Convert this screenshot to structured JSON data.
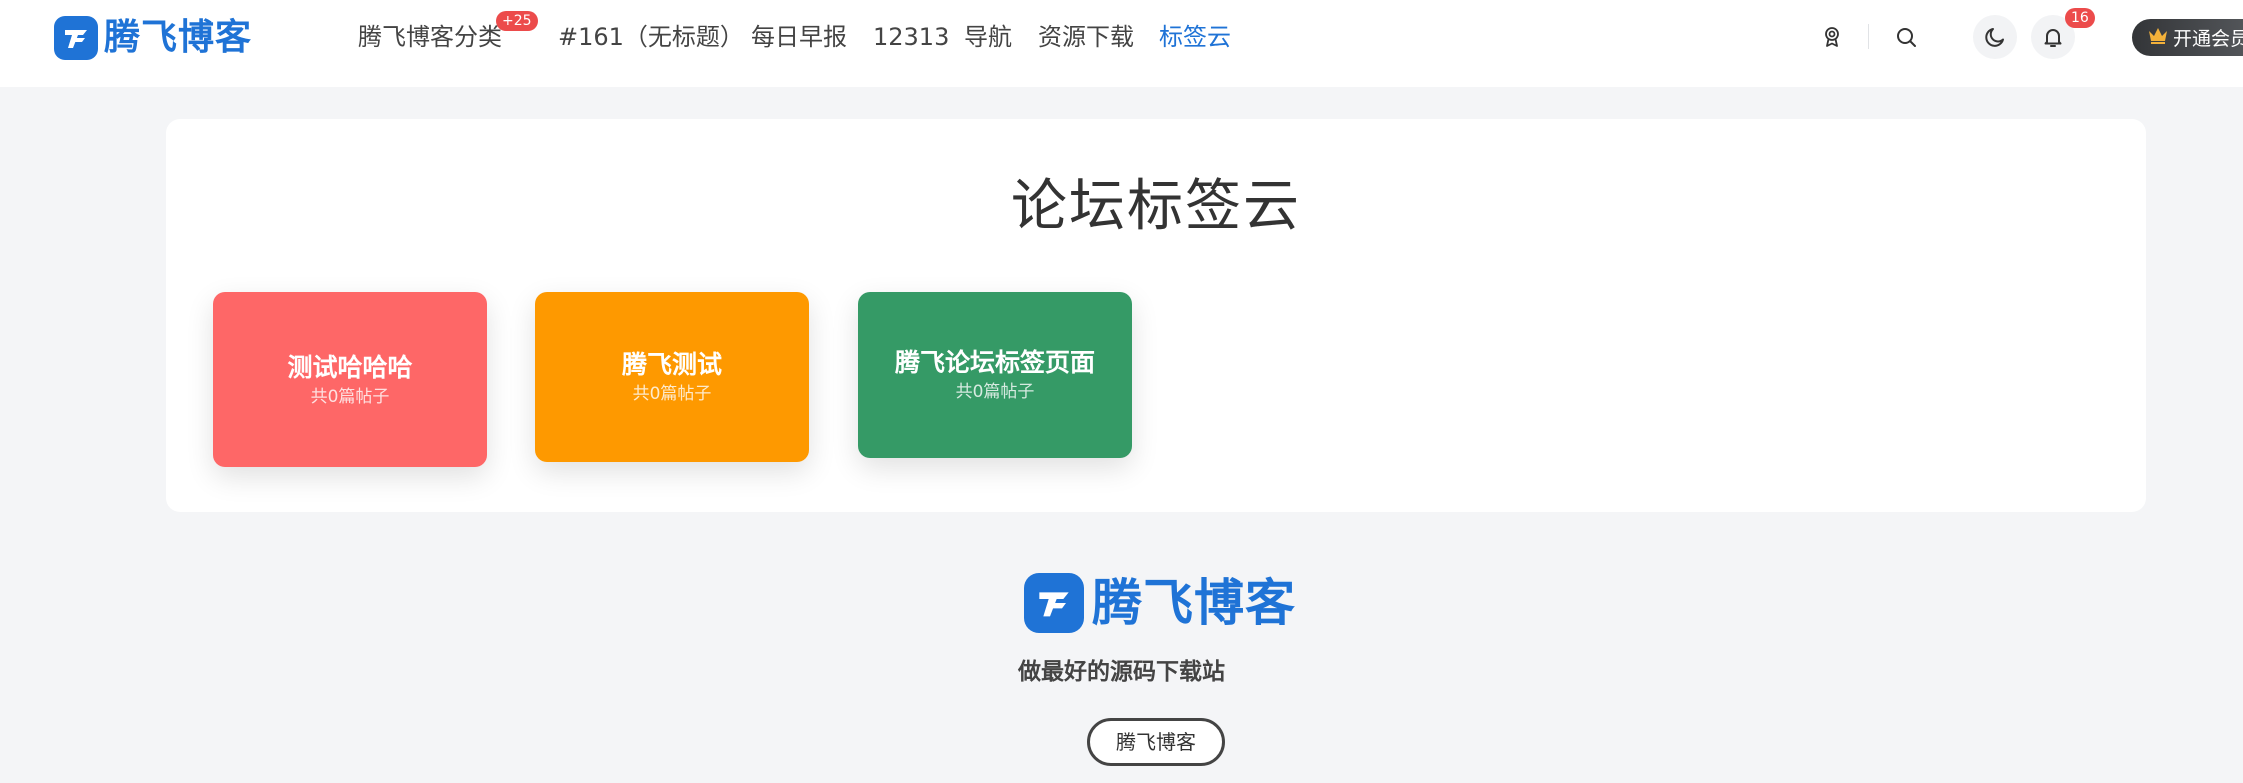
{
  "header": {
    "logo_text": "腾飞博客",
    "nav": [
      {
        "label": "腾飞博客分类",
        "badge": "+25"
      },
      {
        "label": "#161（无标题）"
      },
      {
        "label": "每日早报"
      },
      {
        "label": "12313"
      },
      {
        "label": "导航"
      },
      {
        "label": "资源下载"
      },
      {
        "label": "标签云",
        "active": true
      }
    ],
    "notification_count": "16",
    "vip_label": "开通会员",
    "icons": [
      "badge-icon",
      "search-icon",
      "moon-icon",
      "bell-icon",
      "crown-icon"
    ]
  },
  "main": {
    "title": "论坛标签云",
    "tags": [
      {
        "name": "测试哈哈哈",
        "count": "共0篇帖子",
        "color": "#fe6767"
      },
      {
        "name": "腾飞测试",
        "count": "共0篇帖子",
        "color": "#fe9900"
      },
      {
        "name": "腾飞论坛标签页面",
        "count": "共0篇帖子",
        "color": "#359a66"
      }
    ]
  },
  "footer": {
    "logo_text": "腾飞博客",
    "slogan": "做最好的源码下载站",
    "button_label": "腾飞博客"
  },
  "colors": {
    "brand": "#1f73d6",
    "badge": "#ec4b4b",
    "background": "#f4f5f7"
  }
}
